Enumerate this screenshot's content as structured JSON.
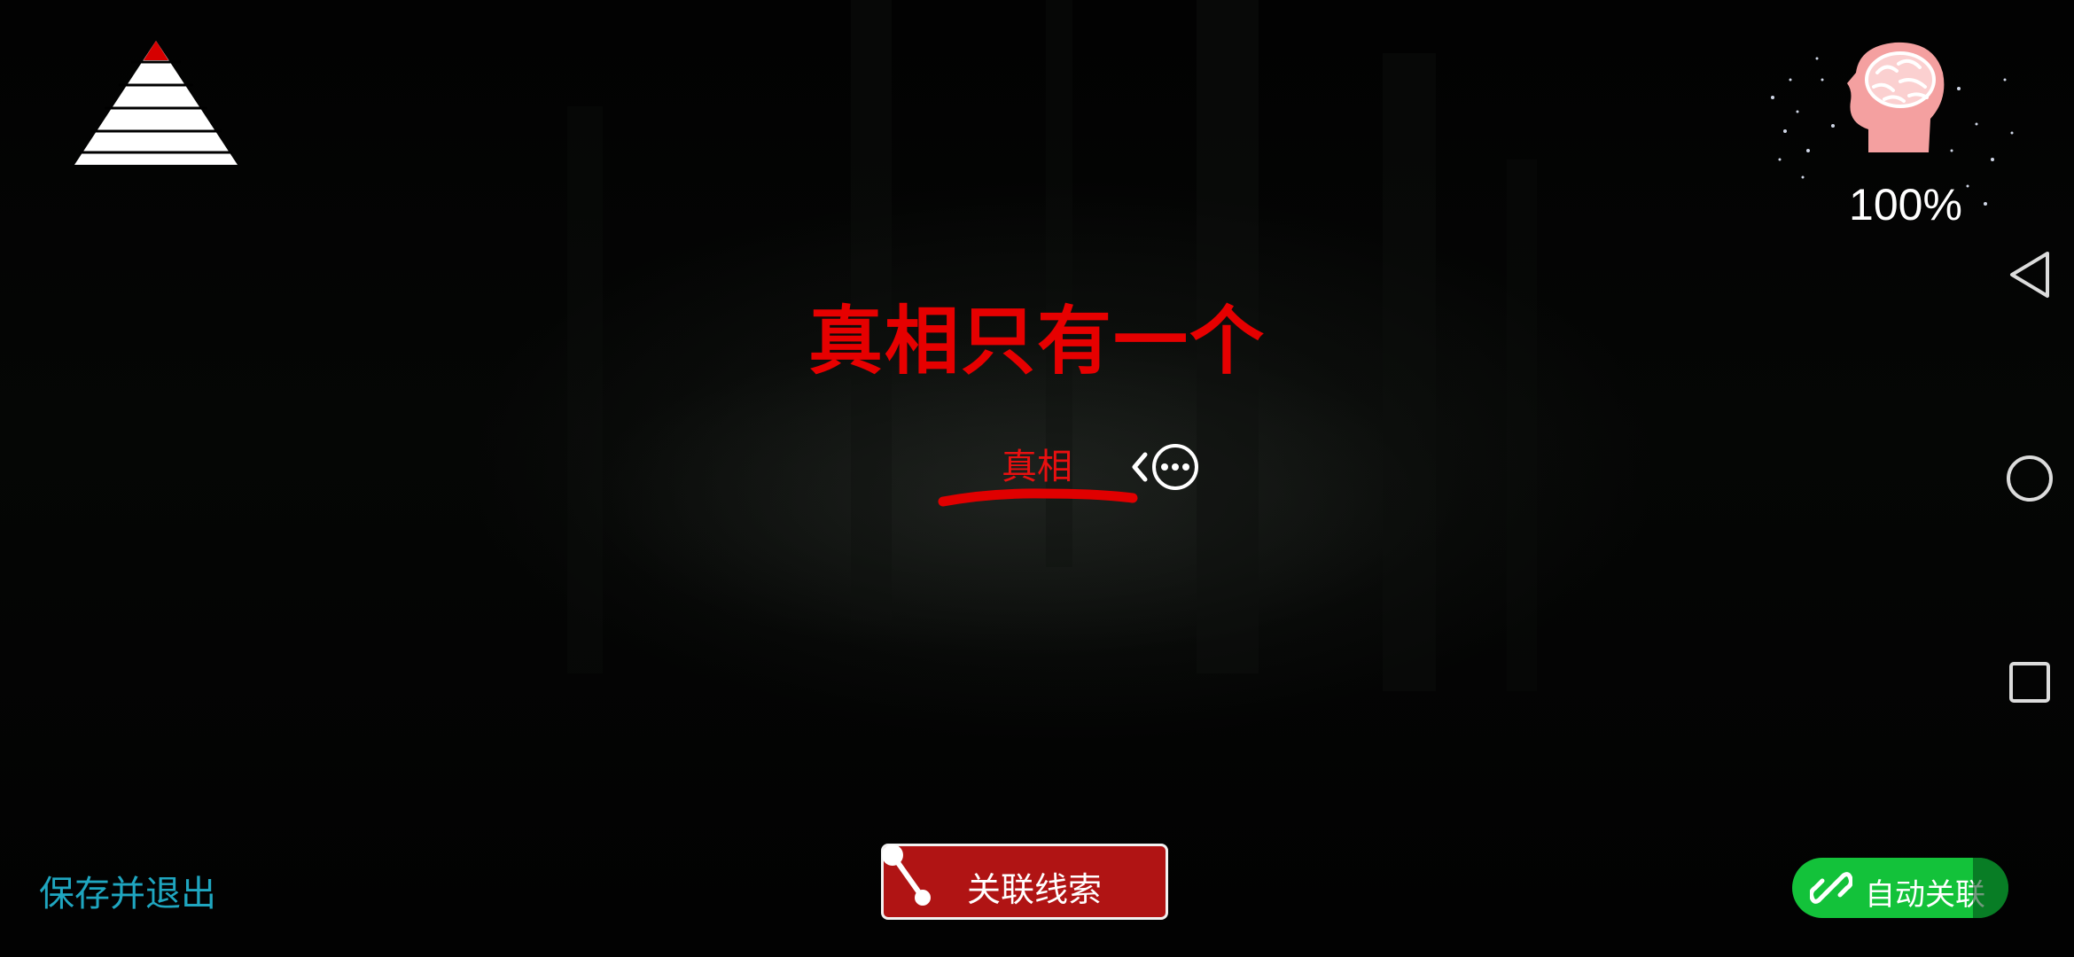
{
  "hud": {
    "sanity_percent": "100%"
  },
  "puzzle": {
    "headline": "真相只有一个",
    "keyword": "真相"
  },
  "controls": {
    "save_exit_label": "保存并退出",
    "link_clues_label": "关联线索",
    "auto_link_label": "自动关联"
  },
  "colors": {
    "headline_red": "#e60000",
    "link_button_red": "#b01414",
    "auto_link_green": "#13c23a",
    "save_exit_cyan": "#1fa6c0",
    "brain_pink": "#f4a0a0"
  },
  "icons": {
    "menu": "pyramid-icon",
    "sanity": "brain-head-icon",
    "clue_link": "link-node-icon",
    "auto_link": "chain-link-icon",
    "nav_back": "triangle-back-icon",
    "nav_home": "circle-home-icon",
    "nav_recent": "square-recent-icon"
  }
}
